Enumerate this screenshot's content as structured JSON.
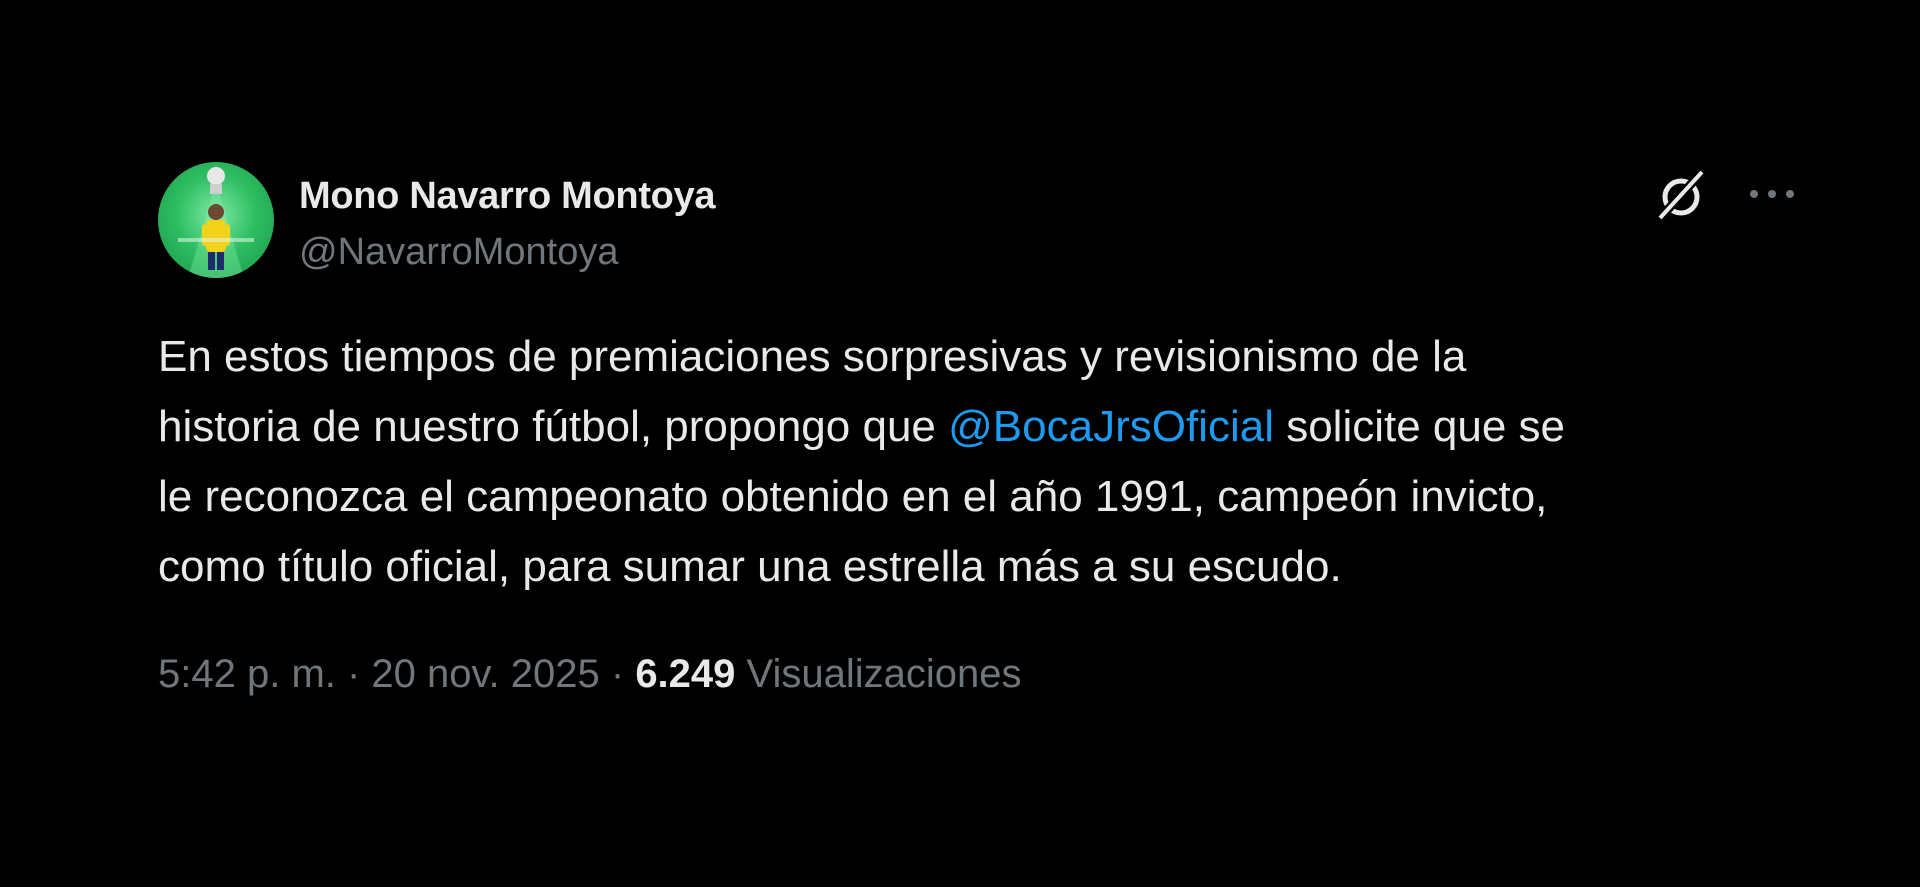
{
  "author": {
    "display_name": "Mono Navarro Montoya",
    "handle": "@NavarroMontoya"
  },
  "icons": {
    "grok": "grok-icon",
    "more": "more-horizontal-icon"
  },
  "tweet": {
    "text_line1": "En estos tiempos de premiaciones sorpresivas y revisionismo de la",
    "text_line2_before": "historia de nuestro fútbol, propongo que ",
    "mention": "@BocaJrsOficial",
    "text_line2_after": " solicite que se",
    "text_line3": "le reconozca el campeonato obtenido en el año 1991, campeón invicto,",
    "text_line4": "como título oficial, para sumar  una estrella más a su escudo."
  },
  "meta": {
    "time": "5:42 p. m.",
    "separator": " · ",
    "date": "20 nov. 2025",
    "views_count": "6.249",
    "views_label": " Visualizaciones"
  },
  "colors": {
    "background": "#000000",
    "text": "#e7e9ea",
    "secondary": "#71767b",
    "mention": "#1d9bf0",
    "avatar_green": "#2fbf63"
  }
}
